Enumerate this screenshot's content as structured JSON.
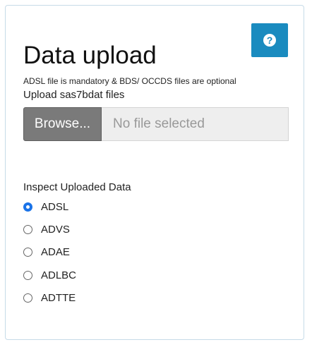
{
  "panel": {
    "title": "Data upload",
    "note": "ADSL file is mandatory & BDS/ OCCDS files are optional",
    "help_icon": "question-circle-icon",
    "accent_color": "#1a8bbf"
  },
  "upload": {
    "label": "Upload sas7bdat files",
    "browse_label": "Browse...",
    "file_status": "No file selected"
  },
  "inspect": {
    "label": "Inspect Uploaded Data",
    "selected": "ADSL",
    "options": [
      {
        "label": "ADSL",
        "checked": true
      },
      {
        "label": "ADVS",
        "checked": false
      },
      {
        "label": "ADAE",
        "checked": false
      },
      {
        "label": "ADLBC",
        "checked": false
      },
      {
        "label": "ADTTE",
        "checked": false
      }
    ]
  }
}
